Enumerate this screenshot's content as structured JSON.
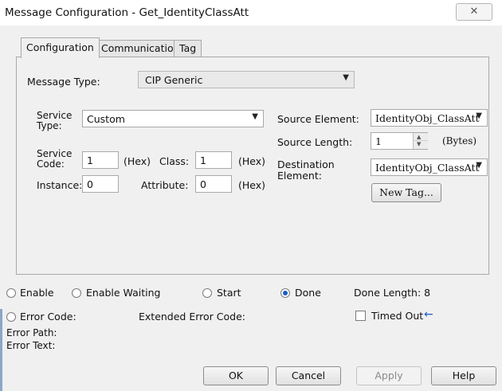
{
  "window": {
    "title": "Message Configuration - Get_IdentityClassAtt",
    "close_glyph": "✕"
  },
  "tabs": [
    {
      "label": "Configuration",
      "active": true
    },
    {
      "label": "Communication",
      "active": false
    },
    {
      "label": "Tag",
      "active": false
    }
  ],
  "config": {
    "message_type_label": "Message Type:",
    "message_type_value": "CIP Generic",
    "service_type_label_1": "Service",
    "service_type_label_2": "Type:",
    "service_type_value": "Custom",
    "service_code_label_1": "Service",
    "service_code_label_2": "Code:",
    "service_code_value": "1",
    "hex_label": "(Hex)",
    "class_label": "Class:",
    "class_value": "1",
    "instance_label": "Instance:",
    "instance_value": "0",
    "attribute_label": "Attribute:",
    "attribute_value": "0",
    "source_element_label": "Source Element:",
    "source_element_value": "IdentityObj_ClassAtt",
    "source_length_label": "Source Length:",
    "source_length_value": "1",
    "bytes_label": "(Bytes)",
    "destination_label_1": "Destination",
    "destination_label_2": "Element:",
    "destination_value": "IdentityObj_ClassAtt",
    "new_tag_button": "New Tag..."
  },
  "status": {
    "enable": "Enable",
    "enable_waiting": "Enable Waiting",
    "start": "Start",
    "done": "Done",
    "done_length": "Done Length: 8",
    "error_code": "Error Code:",
    "extended_error_code": "Extended Error Code:",
    "timed_out": "Timed Out",
    "error_path": "Error Path:",
    "error_text": "Error Text:",
    "selected": "done"
  },
  "buttons": {
    "ok": "OK",
    "cancel": "Cancel",
    "apply": "Apply",
    "help": "Help"
  },
  "icons": {
    "dropdown": "chevron-down-icon",
    "spinner": "spinner-icon",
    "timed_out_arrow": "arrow-left-icon"
  },
  "colors": {
    "accent_blue": "#1c5cc8"
  }
}
